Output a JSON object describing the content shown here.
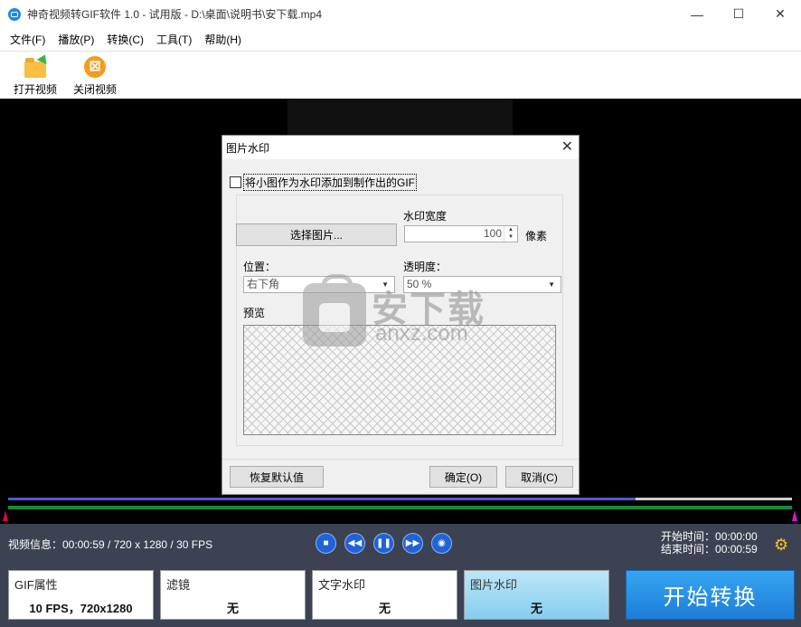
{
  "window": {
    "title": "神奇视频转GIF软件 1.0 - 试用版 - D:\\桌面\\说明书\\安下载.mp4",
    "minimize": "—",
    "maximize": "☐",
    "close": "✕"
  },
  "menu": [
    "文件(F)",
    "播放(P)",
    "转换(C)",
    "工具(T)",
    "帮助(H)"
  ],
  "toolbar": {
    "open_video": "打开视频",
    "close_video": "关闭视频"
  },
  "timeline": {
    "played_fraction": 0.8
  },
  "controls": {
    "video_info": "视频信息：00:00:59 / 720 x 1280 / 30 FPS",
    "start_time_label": "开始时间：",
    "start_time": "00:00:00",
    "end_time_label": "结束时间：",
    "end_time": "00:00:59",
    "buttons": [
      "stop-icon",
      "rewind-icon",
      "pause-icon",
      "fast-forward-icon",
      "camera-icon"
    ]
  },
  "panels": {
    "gif": {
      "title": "GIF属性",
      "value": "10 FPS，720x1280"
    },
    "filter": {
      "title": "滤镜",
      "value": "无"
    },
    "text_wm": {
      "title": "文字水印",
      "value": "无"
    },
    "image_wm": {
      "title": "图片水印",
      "value": "无"
    }
  },
  "start_button": "开始转换",
  "dialog": {
    "title": "图片水印",
    "close": "✕",
    "checkbox_label": "将小图作为水印添加到制作出的GIF",
    "checkbox_checked": false,
    "select_image_button": "选择图片...",
    "width_label": "水印宽度",
    "width_value": "100",
    "width_unit": "像素",
    "position_label": "位置：",
    "position_value": "右下角",
    "opacity_label": "透明度：",
    "opacity_value": "50 %",
    "preview_label": "预览",
    "reset_button": "恢复默认值",
    "ok_button": "确定(O)",
    "cancel_button": "取消(C)"
  },
  "watermark": {
    "text": "安下载",
    "domain": "anxz.com"
  },
  "colors": {
    "accent_blue": "#1d7ed6",
    "controlbar_bg": "#3d4252",
    "timeline_played": "#4b5ad6",
    "timeline_range": "#138a3a",
    "settings_icon": "#f2c228"
  }
}
